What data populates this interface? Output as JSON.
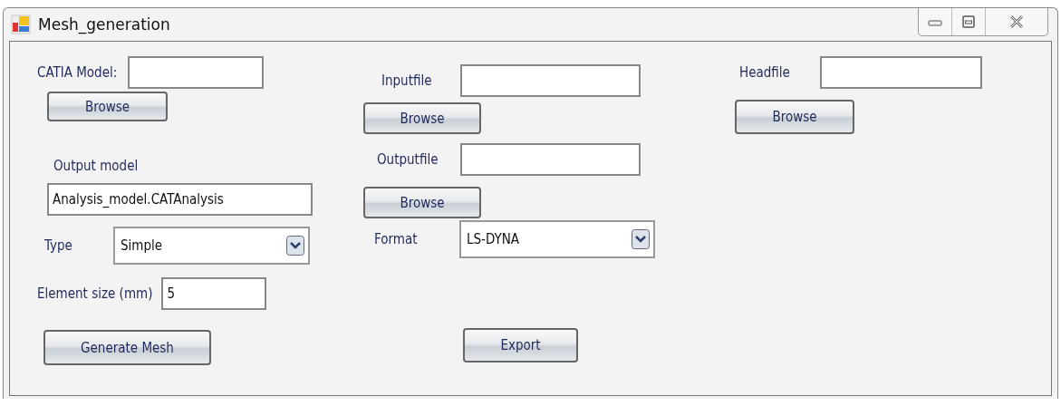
{
  "window": {
    "title": "Mesh_generation"
  },
  "catia_model": {
    "label": "CATIA Model:",
    "button": "Browse"
  },
  "output_model": {
    "label": "Output model",
    "value": "Analysis_model.CATAnalysis"
  },
  "type": {
    "label": "Type",
    "value": "Simple"
  },
  "element_size": {
    "label": "Element size (mm)",
    "value": "5"
  },
  "generate_button": "Generate Mesh",
  "inputfile": {
    "label": "Inputfile",
    "button": "Browse"
  },
  "outputfile": {
    "label": "Outputfile",
    "button": "Browse"
  },
  "format": {
    "label": "Format",
    "value": "LS-DYNA"
  },
  "export_button": "Export",
  "headfile": {
    "label": "Headfile",
    "button": "Browse"
  }
}
